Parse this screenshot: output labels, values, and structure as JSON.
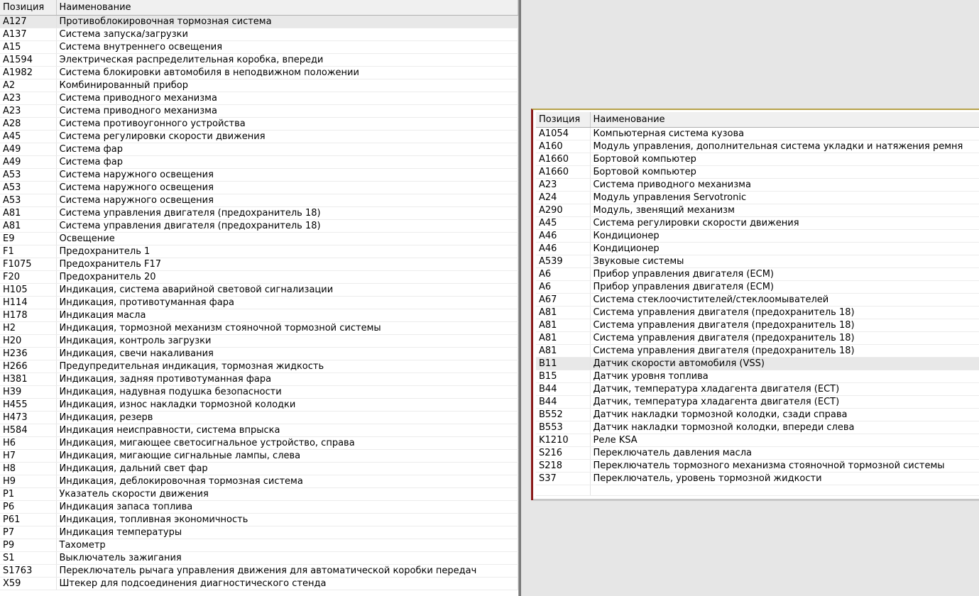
{
  "left_table": {
    "headers": [
      "Позиция",
      "Наименование"
    ],
    "selected_index": 0,
    "rows": [
      [
        "A127",
        "Противоблокировочная тормозная система"
      ],
      [
        "A137",
        "Система запуска/загрузки"
      ],
      [
        "A15",
        "Система внутреннего освещения"
      ],
      [
        "A1594",
        "Электрическая распределительная коробка, впереди"
      ],
      [
        "A1982",
        "Система блокировки автомобиля в неподвижном положении"
      ],
      [
        "A2",
        "Комбинированный прибор"
      ],
      [
        "A23",
        "Система приводного механизма"
      ],
      [
        "A23",
        "Система приводного механизма"
      ],
      [
        "A28",
        "Система противоугонного устройства"
      ],
      [
        "A45",
        "Система регулировки скорости движения"
      ],
      [
        "A49",
        "Система фар"
      ],
      [
        "A49",
        "Система фар"
      ],
      [
        "A53",
        "Система наружного освещения"
      ],
      [
        "A53",
        "Система наружного освещения"
      ],
      [
        "A53",
        "Система наружного освещения"
      ],
      [
        "A81",
        "Система управления двигателя (предохранитель 18)"
      ],
      [
        "A81",
        "Система управления двигателя (предохранитель 18)"
      ],
      [
        "E9",
        "Освещение"
      ],
      [
        "F1",
        "Предохранитель 1"
      ],
      [
        "F1075",
        "Предохранитель F17"
      ],
      [
        "F20",
        "Предохранитель 20"
      ],
      [
        "H105",
        "Индикация, система аварийной световой сигнализации"
      ],
      [
        "H114",
        "Индикация, противотуманная фара"
      ],
      [
        "H178",
        "Индикация масла"
      ],
      [
        "H2",
        "Индикация, тормозной механизм стояночной тормозной системы"
      ],
      [
        "H20",
        "Индикация, контроль загрузки"
      ],
      [
        "H236",
        "Индикация, свечи накаливания"
      ],
      [
        "H266",
        "Предупредительная индикация, тормозная жидкость"
      ],
      [
        "H381",
        "Индикация, задняя противотуманная фара"
      ],
      [
        "H39",
        "Индикация, надувная подушка безопасности"
      ],
      [
        "H455",
        "Индикация, износ накладки тормозной колодки"
      ],
      [
        "H473",
        "Индикация, резерв"
      ],
      [
        "H584",
        "Индикация неисправности, система впрыска"
      ],
      [
        "H6",
        "Индикация, мигающее светосигнальное устройство, справа"
      ],
      [
        "H7",
        "Индикация, мигающие сигнальные лампы, слева"
      ],
      [
        "H8",
        "Индикация, дальний свет фар"
      ],
      [
        "H9",
        "Индикация, деблокировочная тормозная система"
      ],
      [
        "P1",
        "Указатель скорости движения"
      ],
      [
        "P6",
        "Индикация запаса топлива"
      ],
      [
        "P61",
        "Индикация, топливная экономичность"
      ],
      [
        "P7",
        "Индикация температуры"
      ],
      [
        "P9",
        "Тахометр"
      ],
      [
        "S1",
        "Выключатель зажигания"
      ],
      [
        "S1763",
        "Переключатель рычага управления движения для автоматической коробки передач"
      ],
      [
        "X59",
        "Штекер для подсоединения диагностического стенда"
      ]
    ]
  },
  "right_table": {
    "headers": [
      "Позиция",
      "Наименование"
    ],
    "selected_index": 18,
    "rows": [
      [
        "A1054",
        "Компьютерная система кузова"
      ],
      [
        "A160",
        "Модуль управления, дополнительная система укладки и натяжения ремня"
      ],
      [
        "A1660",
        "Бортовой компьютер"
      ],
      [
        "A1660",
        "Бортовой компьютер"
      ],
      [
        "A23",
        "Система приводного механизма"
      ],
      [
        "A24",
        "Модуль управления Servotronic"
      ],
      [
        "A290",
        "Модуль, звенящий механизм"
      ],
      [
        "A45",
        "Система регулировки скорости движения"
      ],
      [
        "A46",
        "Кондиционер"
      ],
      [
        "A46",
        "Кондиционер"
      ],
      [
        "A539",
        "Звуковые системы"
      ],
      [
        "A6",
        "Прибор управления двигателя (ECM)"
      ],
      [
        "A6",
        "Прибор управления двигателя (ECM)"
      ],
      [
        "A67",
        "Система стеклоочистителей/стеклоомывателей"
      ],
      [
        "A81",
        "Система управления двигателя (предохранитель 18)"
      ],
      [
        "A81",
        "Система управления двигателя (предохранитель 18)"
      ],
      [
        "A81",
        "Система управления двигателя (предохранитель 18)"
      ],
      [
        "A81",
        "Система управления двигателя (предохранитель 18)"
      ],
      [
        "B11",
        "Датчик скорости автомобиля (VSS)"
      ],
      [
        "B15",
        "Датчик уровня топлива"
      ],
      [
        "B44",
        "Датчик, температура хладагента двигателя (ECT)"
      ],
      [
        "B44",
        "Датчик, температура хладагента двигателя (ECT)"
      ],
      [
        "B552",
        "Датчик накладки тормозной колодки, сзади справа"
      ],
      [
        "B553",
        "Датчик накладки тормозной колодки, впереди слева"
      ],
      [
        "K1210",
        "Реле KSA"
      ],
      [
        "S216",
        "Переключатель давления масла"
      ],
      [
        "S218",
        "Переключатель тормозного механизма стояночной тормозной системы"
      ],
      [
        "S37",
        "Переключатель, уровень тормозной жидкости"
      ]
    ]
  }
}
